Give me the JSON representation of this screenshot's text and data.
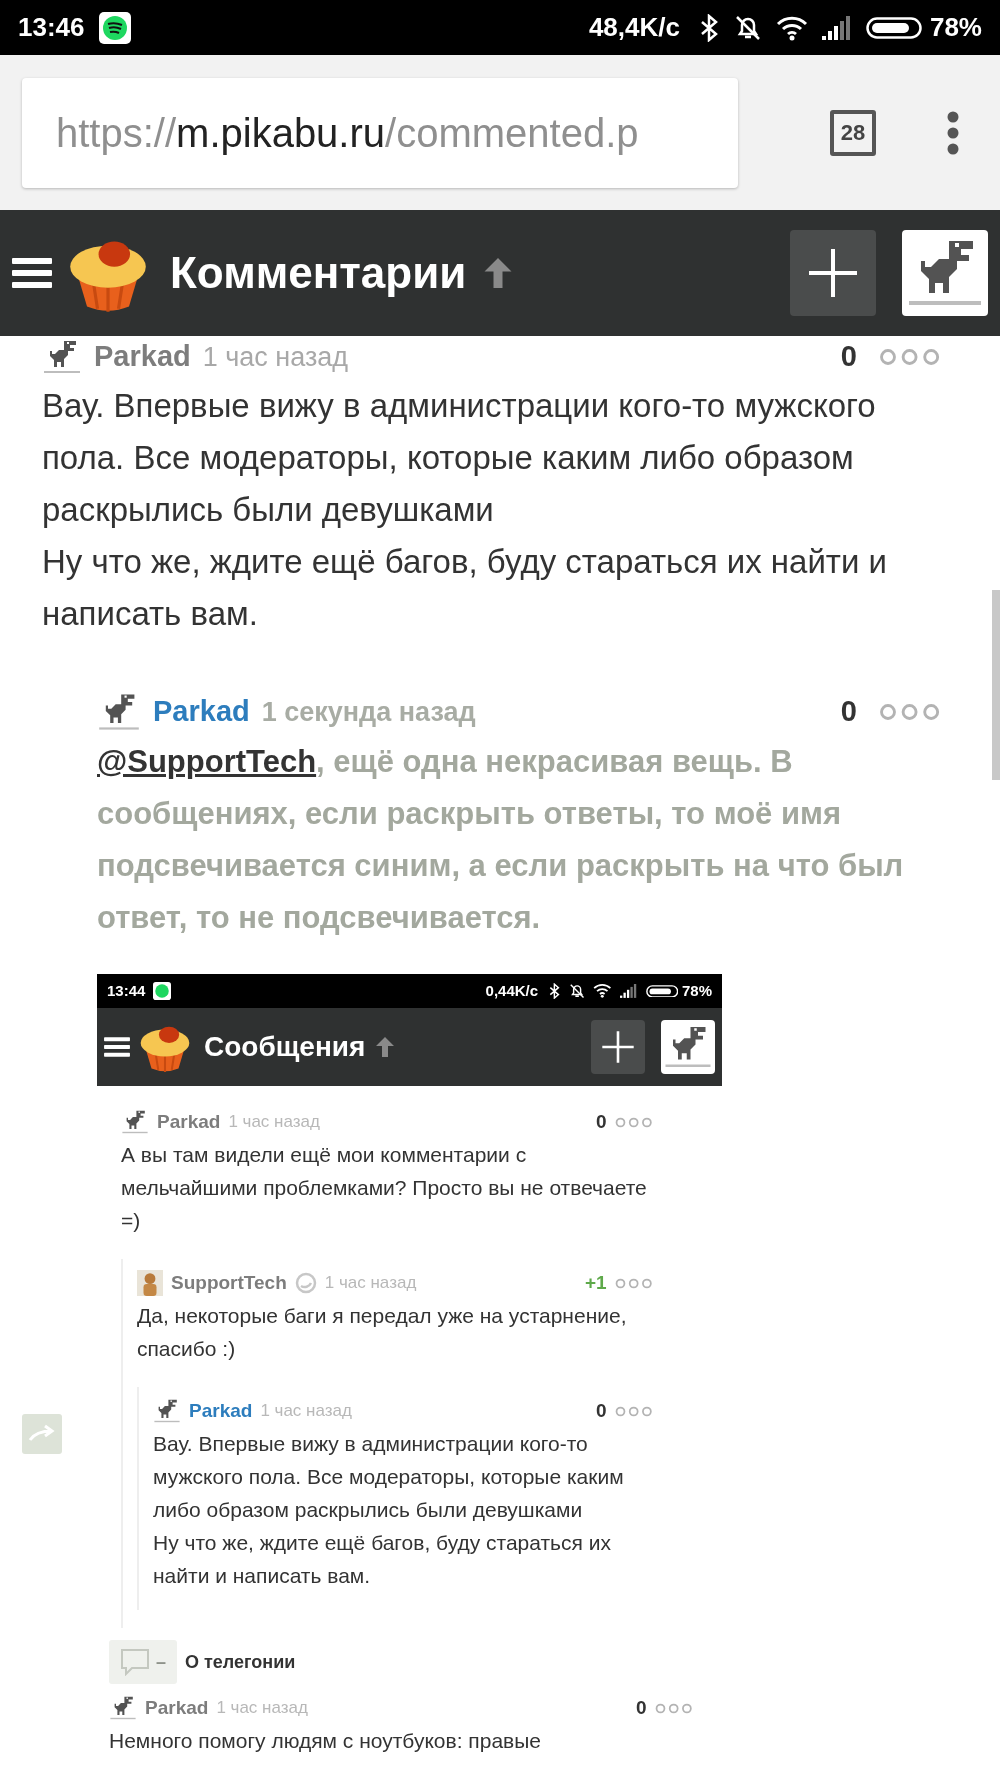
{
  "status_bar": {
    "time": "13:46",
    "network_speed": "48,4K/с",
    "battery": "78%"
  },
  "browser": {
    "url_scheme": "https://",
    "url_host": "m.pikabu.ru",
    "url_path": "/commented.p",
    "tab_count": "28"
  },
  "header": {
    "title": "Комментарии"
  },
  "comment": {
    "author": "Parkad",
    "highlighted": false,
    "time": "1 час назад",
    "score": "0",
    "text": "Вау. Впервые вижу в администрации кого-то мужского пола. Все модераторы, которые каким либо образом раскрылись были девушками\nНу что же, ждите ещё багов, буду стараться их найти и написать вам."
  },
  "reply": {
    "author": "Parkad",
    "highlighted": true,
    "time": "1 секунда назад",
    "score": "0",
    "mention": "@SupportTech",
    "text": ", ещё одна некрасивая вещь. В сообщениях, если раскрыть ответы, то моё имя подсвечивается синим, а если раскрыть на что был ответ, то не подсвечивается."
  },
  "attached_screenshot": {
    "status_bar": {
      "time": "13:44",
      "network_speed": "0,44K/с",
      "battery": "78%"
    },
    "header": {
      "title": "Сообщения"
    },
    "comments": [
      {
        "author": "Parkad",
        "highlighted": false,
        "kind": "user",
        "time": "1 час назад",
        "score": "0",
        "color": "#333333",
        "text": "А вы там видели ещё мои комментарии с мельчайшими проблемками? Просто вы не отвечаете =)",
        "children": [
          {
            "author": "SupportTech",
            "highlighted": false,
            "kind": "staff",
            "time": "1 час назад",
            "score": "+1",
            "color": "#5ea94a",
            "text": "Да, некоторые баги я передал уже на устарнение, спасибо :)",
            "children": [
              {
                "author": "Parkad",
                "highlighted": true,
                "kind": "user",
                "time": "1 час назад",
                "score": "0",
                "color": "#333333",
                "text": "Вау. Впервые вижу в администрации кого-то мужского пола. Все модераторы, которые каким либо образом раскрылись были девушками\nНу что же, ждите ещё багов, буду стараться их найти и написать вам."
              }
            ]
          }
        ]
      }
    ],
    "post_link": {
      "count": "–",
      "title": "О телегонии"
    },
    "last_comment": {
      "author": "Parkad",
      "highlighted": false,
      "time": "1 час назад",
      "score": "0",
      "text": "Немного помогу людям с ноутбуков: правые"
    }
  }
}
